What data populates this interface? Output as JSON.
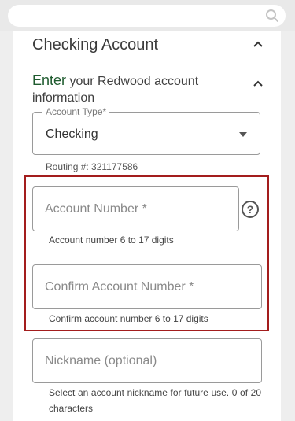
{
  "search": {
    "placeholder": "",
    "icon": "search-icon"
  },
  "section": {
    "title": "Checking Account"
  },
  "subheader": {
    "accent": "Enter",
    "rest": " your Redwood account information"
  },
  "account_type": {
    "legend": "Account Type*",
    "value": "Checking"
  },
  "routing": {
    "text": "Routing #: 321177586"
  },
  "account_number": {
    "placeholder": "Account Number *",
    "hint": "Account number 6 to 17 digits",
    "help": "?"
  },
  "confirm_number": {
    "placeholder": "Confirm Account Number *",
    "hint": "Confirm account number 6 to 17 digits"
  },
  "nickname": {
    "placeholder": "Nickname (optional)",
    "hint": "Select an account nickname for future use. 0 of 20 characters"
  },
  "colors": {
    "accent": "#1f5b2f",
    "highlight": "#a31d1d"
  }
}
